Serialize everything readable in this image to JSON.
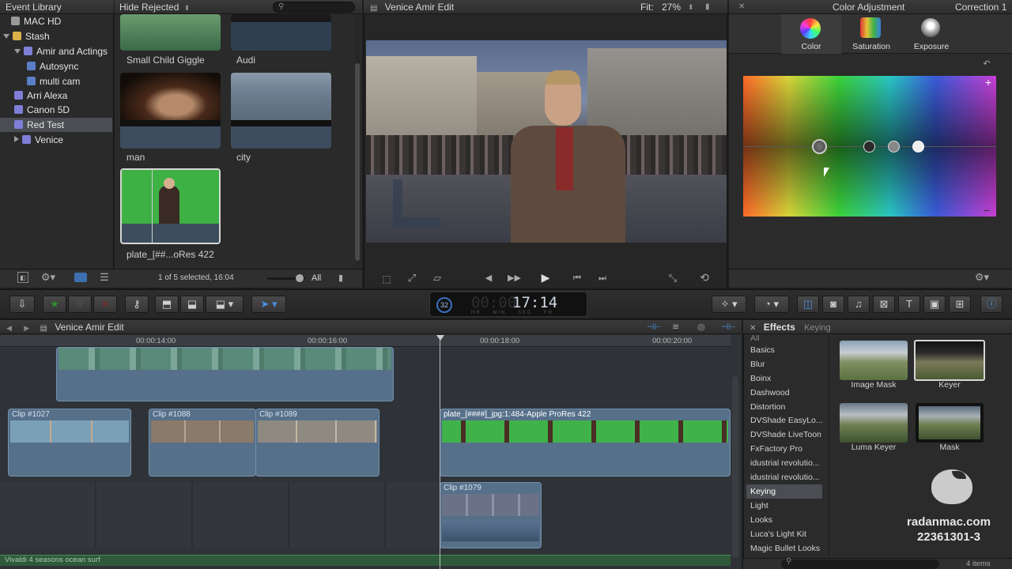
{
  "library": {
    "header": "Event Library",
    "items": [
      {
        "label": "MAC HD",
        "kind": "drive"
      },
      {
        "label": "Stash",
        "kind": "folder"
      },
      {
        "label": "Amir and Actings",
        "kind": "event"
      },
      {
        "label": "Autosync",
        "kind": "project"
      },
      {
        "label": "multi cam",
        "kind": "project"
      },
      {
        "label": "Arri Alexa",
        "kind": "event"
      },
      {
        "label": "Canon 5D",
        "kind": "event"
      },
      {
        "label": "Red Test",
        "kind": "event"
      },
      {
        "label": "Venice",
        "kind": "event"
      }
    ]
  },
  "browser": {
    "filter": "Hide Rejected",
    "clips": [
      "Small Child Giggle",
      "Audi",
      "man",
      "city",
      "plate_[##...oRes 422"
    ],
    "status": "1 of 5 selected, 16:04",
    "all_label": "All"
  },
  "viewer": {
    "title": "Venice Amir Edit",
    "fit_label": "Fit:",
    "fit_value": "27%"
  },
  "inspector": {
    "title": "Color Adjustment",
    "correction": "Correction 1",
    "tabs": [
      "Color",
      "Saturation",
      "Exposure"
    ]
  },
  "toolbar": {
    "timecode_badge": "32",
    "timecode": "17:14",
    "timecode_units": [
      "HR",
      "MIN",
      "SEC",
      "FR"
    ]
  },
  "timeline": {
    "title": "Venice Amir Edit",
    "ruler": [
      "00:00:14:00",
      "00:00:16:00",
      "00:00:18:00",
      "00:00:20:00"
    ],
    "clips": [
      "Clip #1027",
      "Clip #1088",
      "Clip #1089",
      "plate_[####]_jpg:1:484-Apple ProRes 422",
      "Clip #1079"
    ],
    "audio_track": "Vivaldi 4 seasons ocean surf"
  },
  "effects": {
    "header": "Effects",
    "category": "Keying",
    "list": [
      "All",
      "Basics",
      "Blur",
      "Boinx",
      "Dashwood",
      "Distortion",
      "DVShade EasyLo...",
      "DVShade LiveToon",
      "FxFactory Pro",
      "idustrial revolutio...",
      "idustrial revolutio...",
      "Keying",
      "Light",
      "Looks",
      "Luca's Light Kit",
      "Magic Bullet Looks"
    ],
    "selected": "Keying",
    "items": [
      "Image Mask",
      "Keyer",
      "Luma Keyer",
      "Mask"
    ],
    "count": "4 items"
  },
  "watermark": {
    "site": "radanmac.com",
    "code": "22361301-3"
  }
}
